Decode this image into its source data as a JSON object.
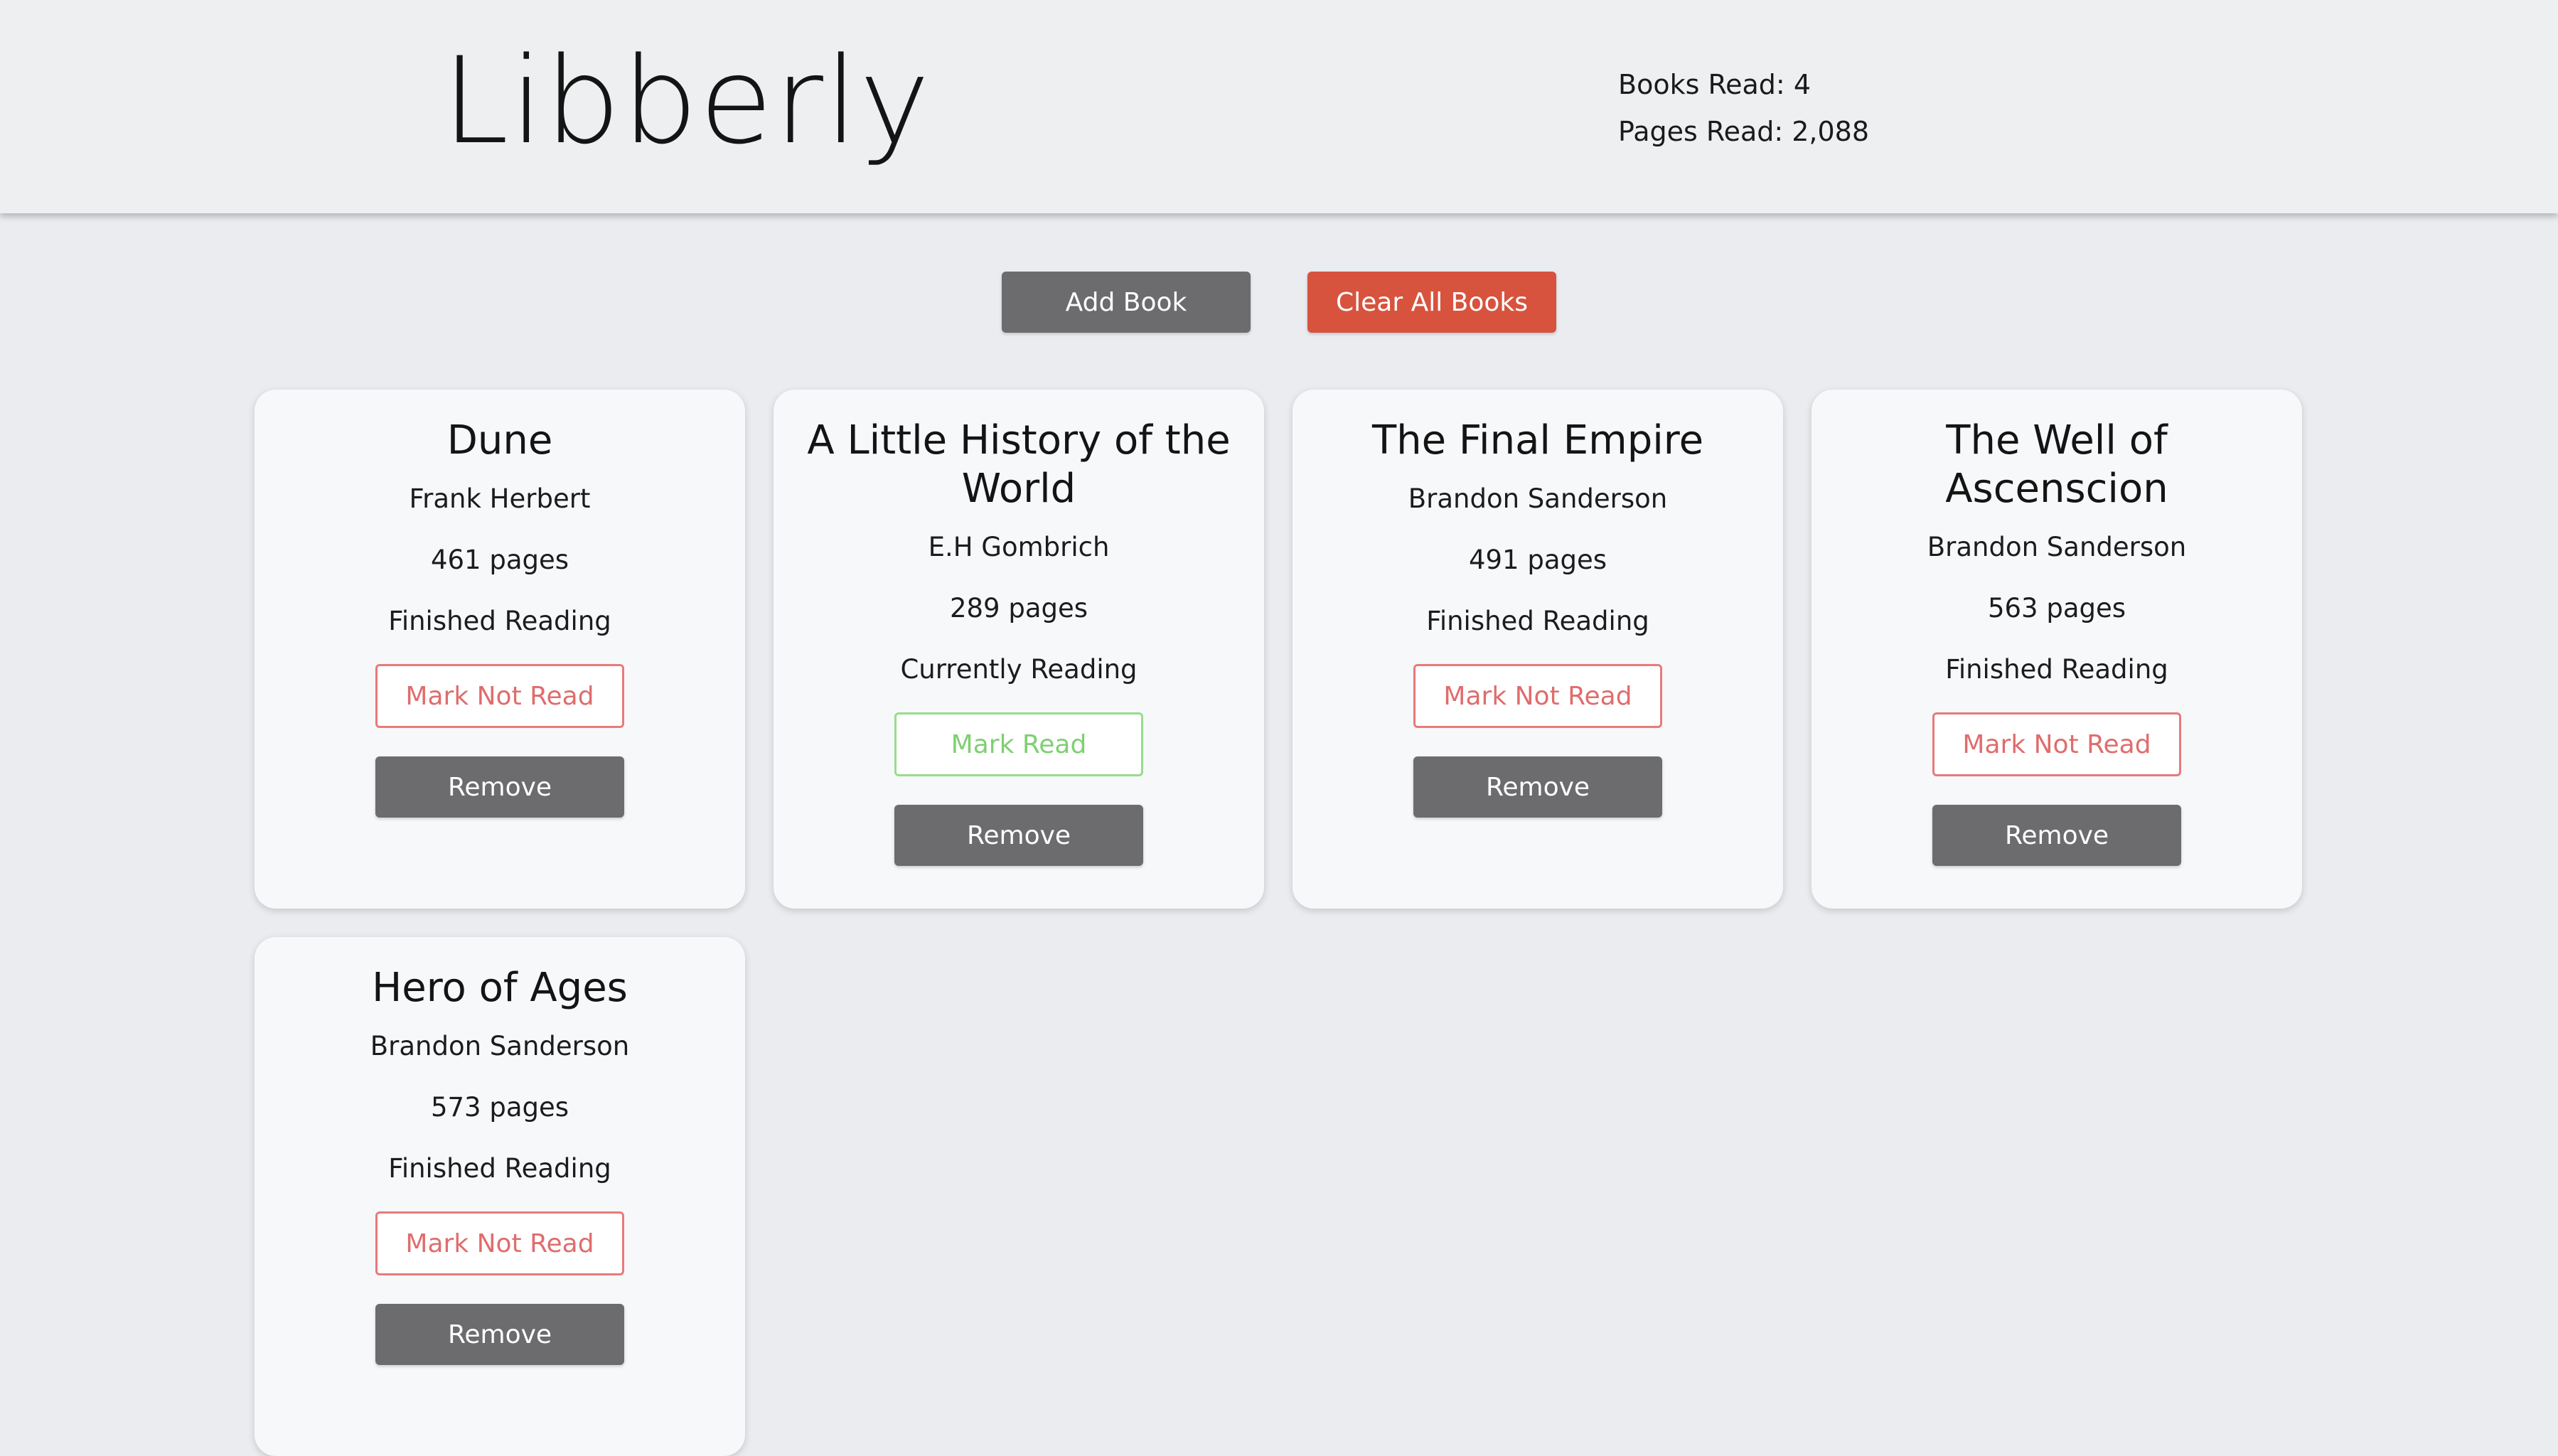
{
  "app": {
    "title": "Libberly"
  },
  "stats": {
    "books_read": "Books Read: 4",
    "pages_read": "Pages Read: 2,088"
  },
  "actions": {
    "add_label": "Add Book",
    "clear_label": "Clear All Books"
  },
  "colors": {
    "accent_red": "#d7533e",
    "button_gray": "#6c6c6e",
    "not_read_red": "#e06c6c",
    "read_green": "#7fcf72"
  },
  "books": [
    {
      "title": "Dune",
      "author": "Frank Herbert",
      "pages": "461 pages",
      "status": "Finished Reading",
      "toggle_label": "Mark Not Read",
      "remove_label": "Remove"
    },
    {
      "title": "A Little History of the World",
      "author": "E.H Gombrich",
      "pages": "289 pages",
      "status": "Currently Reading",
      "toggle_label": "Mark Read",
      "remove_label": "Remove"
    },
    {
      "title": "The Final Empire",
      "author": "Brandon Sanderson",
      "pages": "491 pages",
      "status": "Finished Reading",
      "toggle_label": "Mark Not Read",
      "remove_label": "Remove"
    },
    {
      "title": "The Well of Ascenscion",
      "author": "Brandon Sanderson",
      "pages": "563 pages",
      "status": "Finished Reading",
      "toggle_label": "Mark Not Read",
      "remove_label": "Remove"
    },
    {
      "title": "Hero of Ages",
      "author": "Brandon Sanderson",
      "pages": "573 pages",
      "status": "Finished Reading",
      "toggle_label": "Mark Not Read",
      "remove_label": "Remove"
    }
  ]
}
